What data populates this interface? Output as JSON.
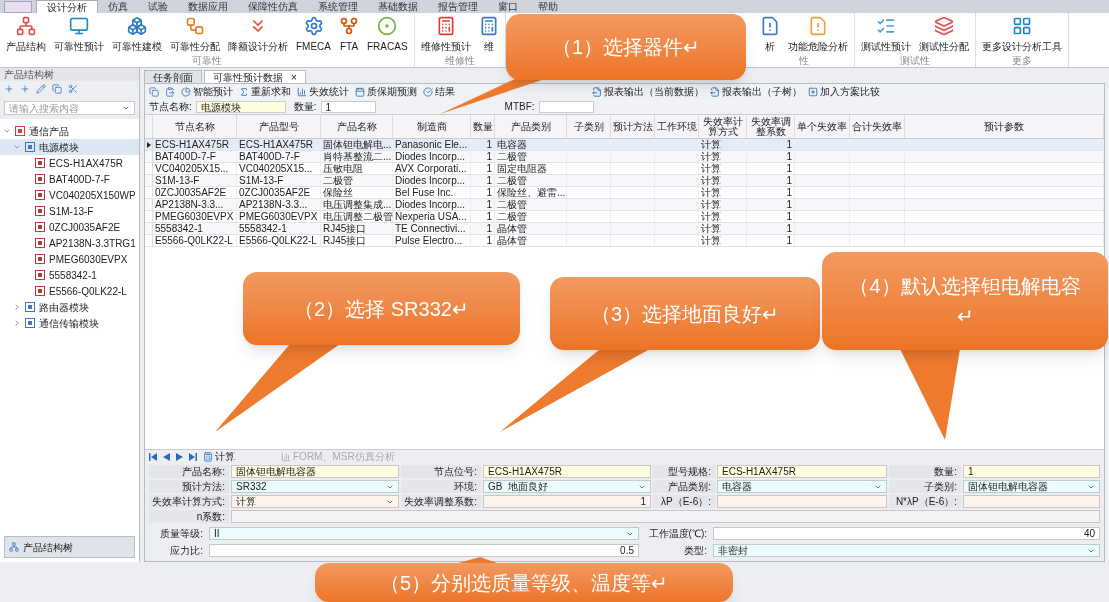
{
  "ribbon_tabs": [
    {
      "label": "设计分析",
      "selected": true
    },
    {
      "label": "仿真",
      "selected": false
    },
    {
      "label": "试验",
      "selected": false
    },
    {
      "label": "数据应用",
      "selected": false
    },
    {
      "label": "保障性仿真",
      "selected": false
    },
    {
      "label": "系统管理",
      "selected": false
    },
    {
      "label": "基础数据",
      "selected": false
    },
    {
      "label": "报告管理",
      "selected": false
    },
    {
      "label": "窗口",
      "selected": false
    },
    {
      "label": "帮助",
      "selected": false
    }
  ],
  "ribbon_groups": [
    {
      "label": "可靠性",
      "buttons": [
        "产品结构",
        "可靠性预计",
        "可靠性建模",
        "可靠性分配",
        "降额设计分析",
        "FMECA",
        "FTA",
        "FRACAS"
      ]
    },
    {
      "label": "维修性",
      "buttons": [
        "维修性预计",
        "维"
      ]
    },
    {
      "label": "性",
      "buttons": [
        "析",
        "功能危险分析"
      ]
    },
    {
      "label": "测试性",
      "buttons": [
        "测试性预计",
        "测试性分配"
      ]
    },
    {
      "label": "更多",
      "buttons": [
        "更多设计分析工具"
      ]
    }
  ],
  "left_panel": {
    "title": "产品结构树",
    "search_placeholder": "请输入搜索内容",
    "footer_button": "产品结构树",
    "tree": [
      {
        "label": "通信产品",
        "expanded": true,
        "children": [
          {
            "label": "电源模块",
            "expanded": true,
            "selected": true,
            "children": [
              {
                "label": "ECS-H1AX475R"
              },
              {
                "label": "BAT400D-7-F"
              },
              {
                "label": "VC040205X150WP"
              },
              {
                "label": "S1M-13-F"
              },
              {
                "label": "0ZCJ0035AF2E"
              },
              {
                "label": "AP2138N-3.3TRG1"
              },
              {
                "label": "PMEG6030EVPX"
              },
              {
                "label": "5558342-1"
              },
              {
                "label": "E5566-Q0LK22-L"
              }
            ]
          },
          {
            "label": "路由器模块",
            "expanded": false,
            "selected": false
          },
          {
            "label": "通信传输模块",
            "expanded": false,
            "selected": false
          }
        ]
      }
    ]
  },
  "doc_tabs": [
    {
      "label": "任务剖面",
      "selected": false
    },
    {
      "label": "可靠性预计数据",
      "selected": true,
      "close": "×"
    }
  ],
  "toolbar": [
    "智能预计",
    "重新求和",
    "失效统计",
    "质保期预测",
    "结果",
    "报表输出（当前数据）",
    "报表输出（子树）",
    "加入方案比较"
  ],
  "node_fields": [
    {
      "label": "节点名称:",
      "value": "电源模块"
    },
    {
      "label": "数量:",
      "value": "1"
    },
    {
      "label": "MTBF:"
    }
  ],
  "table": {
    "columns": [
      "节点名称",
      "产品型号",
      "产品名称",
      "制造商",
      "数量",
      "产品类别",
      "子类别",
      "预计方法",
      "工作环境",
      "失效率计算方式",
      "失效率调整系数",
      "单个失效率",
      "合计失效率",
      "预计参数"
    ],
    "rows": [
      {
        "selected": true,
        "cells": [
          "ECS-H1AX475R",
          "ECS-H1AX475R",
          "固体钽电解电...",
          "Panasonic Ele...",
          "1",
          "电容器",
          "",
          "",
          "",
          "计算",
          "1",
          "",
          "",
          ""
        ]
      },
      {
        "selected": false,
        "cells": [
          "BAT400D-7-F",
          "BAT400D-7-F",
          "肖特基整流二...",
          "Diodes Incorp...",
          "1",
          "二极管",
          "",
          "",
          "",
          "计算",
          "1",
          "",
          "",
          ""
        ]
      },
      {
        "selected": false,
        "cells": [
          "VC040205X15...",
          "VC040205X15...",
          "压敏电阻",
          "AVX Corporati...",
          "1",
          "固定电阻器",
          "",
          "",
          "",
          "计算",
          "1",
          "",
          "",
          ""
        ]
      },
      {
        "selected": false,
        "cells": [
          "S1M-13-F",
          "S1M-13-F",
          "二极管",
          "Diodes Incorp...",
          "1",
          "二极管",
          "",
          "",
          "",
          "计算",
          "1",
          "",
          "",
          ""
        ]
      },
      {
        "selected": false,
        "cells": [
          "0ZCJ0035AF2E",
          "0ZCJ0035AF2E",
          "保险丝",
          "Bel Fuse Inc.",
          "1",
          "保险丝、避雷...",
          "",
          "",
          "",
          "计算",
          "1",
          "",
          "",
          ""
        ]
      },
      {
        "selected": false,
        "cells": [
          "AP2138N-3.3...",
          "AP2138N-3.3...",
          "电压调整集成...",
          "Diodes Incorp...",
          "1",
          "二极管",
          "",
          "",
          "",
          "计算",
          "1",
          "",
          "",
          ""
        ]
      },
      {
        "selected": false,
        "cells": [
          "PMEG6030EVPX",
          "PMEG6030EVPX",
          "电压调整二极管",
          "Nexperia USA...",
          "1",
          "二极管",
          "",
          "",
          "",
          "计算",
          "1",
          "",
          "",
          ""
        ]
      },
      {
        "selected": false,
        "cells": [
          "5558342-1",
          "5558342-1",
          "RJ45接口",
          "TE Connectivi...",
          "1",
          "晶体管",
          "",
          "",
          "",
          "计算",
          "1",
          "",
          "",
          ""
        ]
      },
      {
        "selected": false,
        "cells": [
          "E5566-Q0LK22-L",
          "E5566-Q0LK22-L",
          "RJ45接口",
          "Pulse Electro...",
          "1",
          "晶体管",
          "",
          "",
          "",
          "计算",
          "1",
          "",
          "",
          ""
        ]
      }
    ]
  },
  "nav_bar": [
    {
      "label": "计算",
      "disabled": false
    },
    {
      "label": "FORM、MSR仿真分析",
      "disabled": true
    }
  ],
  "form": [
    [
      {
        "label": "产品名称:",
        "value": "固体钽电解电容器",
        "kind": "readonly"
      },
      {
        "label": "节点位号:",
        "value": "ECS-H1AX475R",
        "kind": "readonly"
      },
      {
        "label": "型号规格:",
        "value": "ECS-H1AX475R",
        "kind": "readonly"
      },
      {
        "label": "数量:",
        "value": "1",
        "kind": "readonly"
      }
    ],
    [
      {
        "label": "预计方法:",
        "value": "SR332",
        "kind": "select"
      },
      {
        "label": "环境:",
        "value": "GB  地面良好",
        "kind": "select"
      },
      {
        "label": "产品类别:",
        "value": "电容器",
        "kind": "select"
      },
      {
        "label": "子类别:",
        "value": "固体钽电解电容器",
        "kind": "select"
      }
    ],
    [
      {
        "label": "失效率计算方式:",
        "value": "计算",
        "kind": "calc-select"
      },
      {
        "label": "失效率调整系数:",
        "value": "1",
        "kind": "calc-spin"
      },
      {
        "label": "λP（E-6）:",
        "kind": "calc"
      },
      {
        "label": "N*λP（E-6）:",
        "kind": "calc"
      }
    ],
    [
      {
        "label": "n系数:",
        "kind": "plain"
      }
    ]
  ],
  "params": [
    [
      {
        "label": "质量等级:",
        "value": "II",
        "kind": "select"
      },
      {
        "label": "工作温度(℃):",
        "value": "40",
        "kind": "number"
      }
    ],
    [
      {
        "label": "应力比:",
        "value": "0.5",
        "kind": "number"
      },
      {
        "label": "类型:",
        "value": "非密封",
        "kind": "select"
      }
    ]
  ],
  "callouts": [
    {
      "text": "（1）选择器件↵"
    },
    {
      "text": "（2）选择 SR332↵"
    },
    {
      "text": "（3）选择地面良好↵"
    },
    {
      "text": "（4）默认选择钽电解电容↵"
    },
    {
      "text": "（5）分别选质量等级、温度等↵"
    }
  ]
}
